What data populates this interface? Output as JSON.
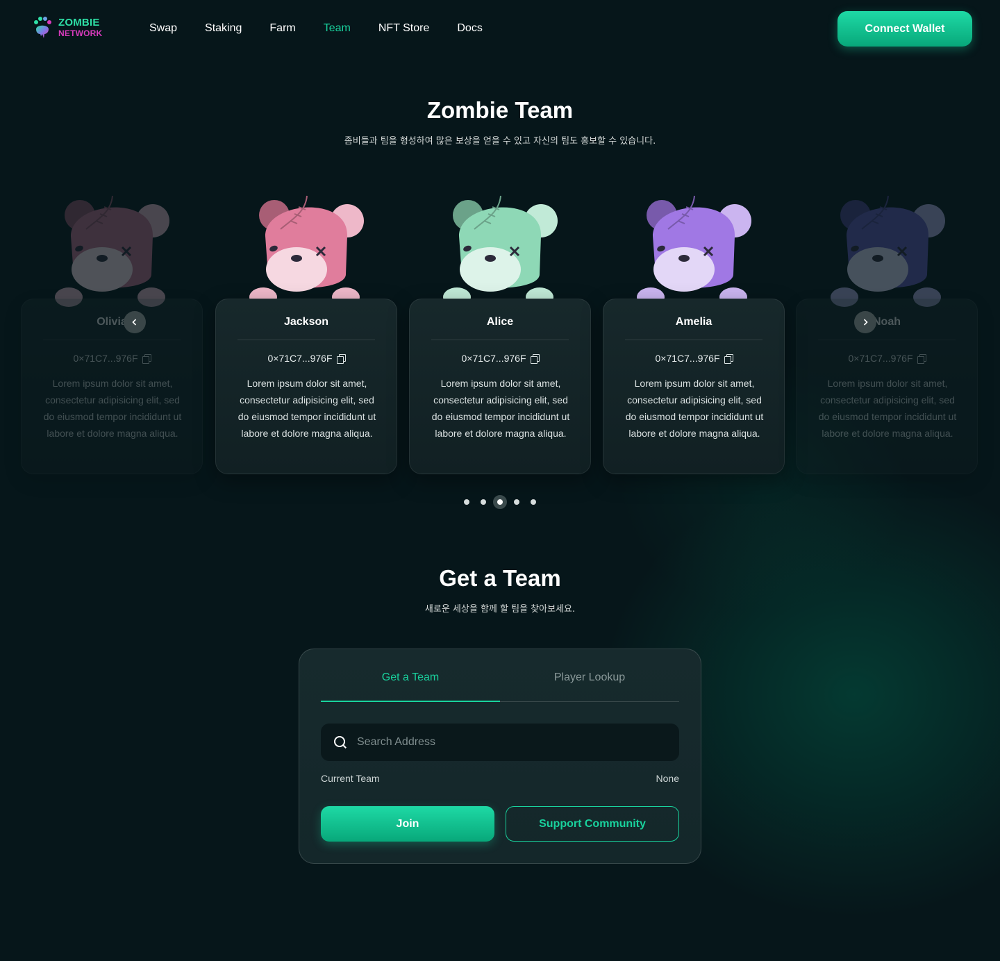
{
  "brand": {
    "line1": "ZOMBIE",
    "line2": "NETWORK"
  },
  "nav": {
    "items": [
      {
        "label": "Swap"
      },
      {
        "label": "Staking"
      },
      {
        "label": "Farm"
      },
      {
        "label": "Team",
        "active": true
      },
      {
        "label": "NFT Store"
      },
      {
        "label": "Docs"
      }
    ],
    "connect_label": "Connect Wallet"
  },
  "team_section": {
    "title": "Zombie Team",
    "subtitle": "좀비들과 팀을 형성하여 많은 보상을 얻을 수 있고 자신의 팀도 홍보할 수 있습니다.",
    "members": [
      {
        "name": "Olivia",
        "address": "0×71C7...976F",
        "description": "Lorem ipsum dolor sit amet, consectetur adipisicing elit, sed do eiusmod tempor incididunt ut labore et dolore magna aliqua.",
        "color": "#b56a86",
        "faded": true
      },
      {
        "name": "Jackson",
        "address": "0×71C7...976F",
        "description": "Lorem ipsum dolor sit amet, consectetur adipisicing elit, sed do eiusmod tempor incididunt ut labore et dolore magna aliqua.",
        "color": "#e07d9c",
        "faded": false
      },
      {
        "name": "Alice",
        "address": "0×71C7...976F",
        "description": "Lorem ipsum dolor sit amet, consectetur adipisicing elit, sed do eiusmod tempor incididunt ut labore et dolore magna aliqua.",
        "color": "#8ed8b6",
        "faded": false
      },
      {
        "name": "Amelia",
        "address": "0×71C7...976F",
        "description": "Lorem ipsum dolor sit amet, consectetur adipisicing elit, sed do eiusmod tempor incididunt ut labore et dolore magna aliqua.",
        "color": "#a078e4",
        "faded": false
      },
      {
        "name": "Noah",
        "address": "0×71C7...976F",
        "description": "Lorem ipsum dolor sit amet, consectetur adipisicing elit, sed do eiusmod tempor incididunt ut labore et dolore magna aliqua.",
        "color": "#5a56b0",
        "faded": true
      }
    ],
    "prev_icon": "chevron-left-icon",
    "next_icon": "chevron-right-icon",
    "pagination": {
      "total": 5,
      "active_index": 2
    }
  },
  "get_team": {
    "title": "Get a Team",
    "subtitle": "새로운 세상을 함께 할 팀을 찾아보세요.",
    "tabs": [
      {
        "label": "Get a Team",
        "active": true
      },
      {
        "label": "Player Lookup",
        "active": false
      }
    ],
    "search": {
      "placeholder": "Search Address",
      "value": ""
    },
    "current_team_label": "Current Team",
    "current_team_value": "None",
    "join_label": "Join",
    "support_label": "Support Community"
  },
  "colors": {
    "accent": "#19d29d",
    "background": "#06161a",
    "card": "#15262a"
  }
}
